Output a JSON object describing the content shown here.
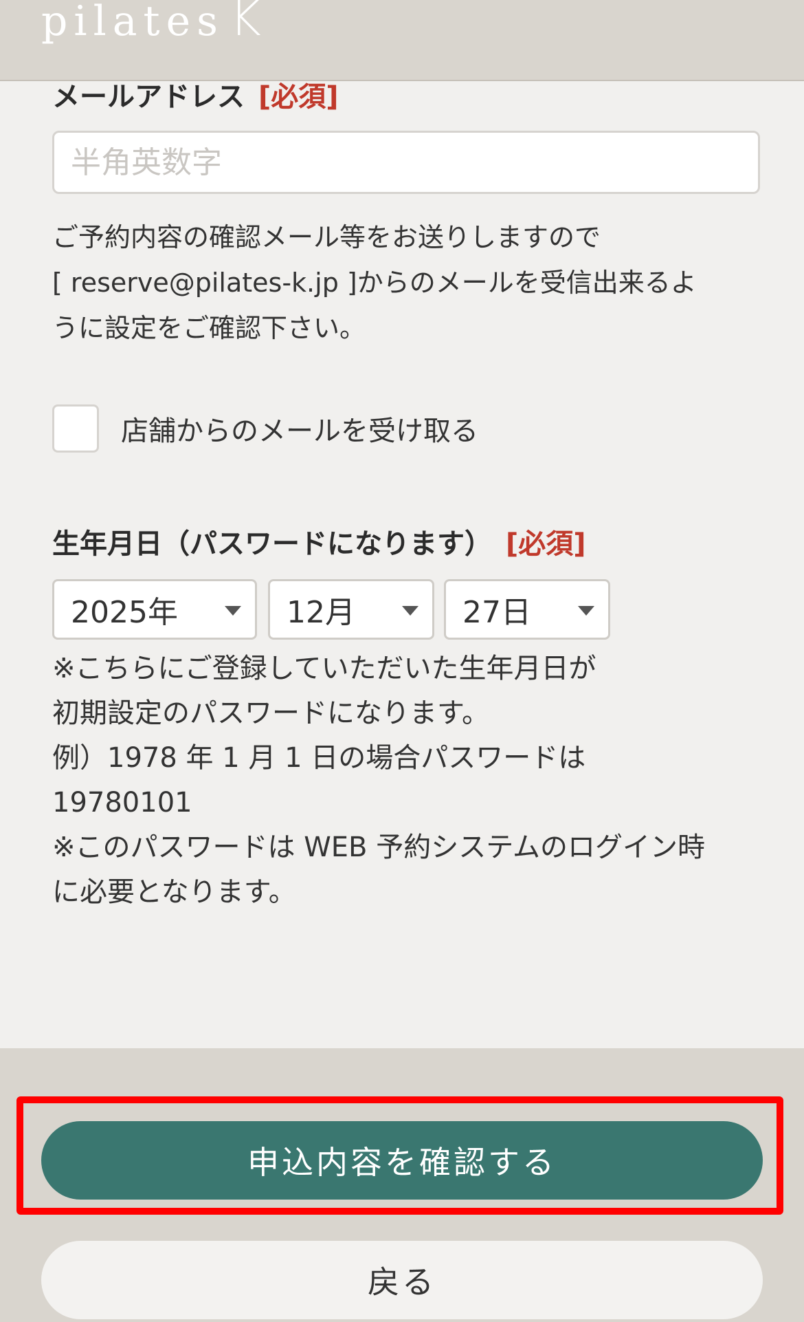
{
  "header": {
    "logo_text": "pilates",
    "logo_mark": "K"
  },
  "email": {
    "label": "メールアドレス",
    "required": "[必須]",
    "placeholder": "半角英数字",
    "value": ""
  },
  "email_notice": {
    "lines": [
      "ご予約内容の確認メール等をお送りしますので",
      "[ reserve@pilates-k.jp ]からのメールを受信出来るよ",
      "うに設定をご確認下さい。"
    ]
  },
  "mail_opt_in": {
    "label": "店舗からのメールを受け取る",
    "checked": false
  },
  "birthday": {
    "label": "生年月日（パスワードになります）",
    "required": "[必須]",
    "year": "2025年",
    "month": "12月",
    "day": "27日",
    "help_lines": [
      "※こちらにご登録していただいた生年月日が",
      "初期設定のパスワードになります。",
      "例）1978 年 1 月 1 日の場合パスワードは",
      "19780101",
      "※このパスワードは WEB 予約システムのログイン時",
      "に必要となります。"
    ]
  },
  "actions": {
    "confirm_label": "申込内容を確認する",
    "back_label": "戻る"
  },
  "colors": {
    "header_bg": "#d9d5ce",
    "page_bg": "#f1f0ee",
    "accent_green": "#3a7770",
    "required_red": "#c0392b",
    "highlight_red": "#ff0000"
  }
}
